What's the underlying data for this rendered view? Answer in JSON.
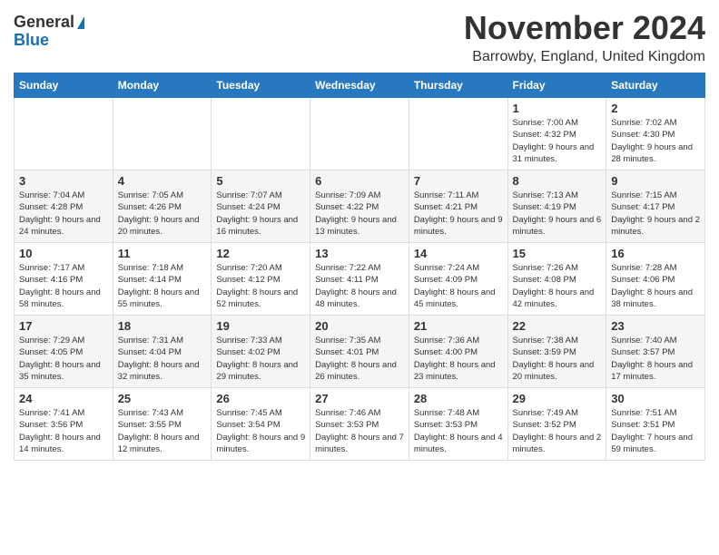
{
  "logo": {
    "general": "General",
    "blue": "Blue"
  },
  "title": "November 2024",
  "location": "Barrowby, England, United Kingdom",
  "days_header": [
    "Sunday",
    "Monday",
    "Tuesday",
    "Wednesday",
    "Thursday",
    "Friday",
    "Saturday"
  ],
  "weeks": [
    [
      {
        "day": "",
        "info": ""
      },
      {
        "day": "",
        "info": ""
      },
      {
        "day": "",
        "info": ""
      },
      {
        "day": "",
        "info": ""
      },
      {
        "day": "",
        "info": ""
      },
      {
        "day": "1",
        "info": "Sunrise: 7:00 AM\nSunset: 4:32 PM\nDaylight: 9 hours and 31 minutes."
      },
      {
        "day": "2",
        "info": "Sunrise: 7:02 AM\nSunset: 4:30 PM\nDaylight: 9 hours and 28 minutes."
      }
    ],
    [
      {
        "day": "3",
        "info": "Sunrise: 7:04 AM\nSunset: 4:28 PM\nDaylight: 9 hours and 24 minutes."
      },
      {
        "day": "4",
        "info": "Sunrise: 7:05 AM\nSunset: 4:26 PM\nDaylight: 9 hours and 20 minutes."
      },
      {
        "day": "5",
        "info": "Sunrise: 7:07 AM\nSunset: 4:24 PM\nDaylight: 9 hours and 16 minutes."
      },
      {
        "day": "6",
        "info": "Sunrise: 7:09 AM\nSunset: 4:22 PM\nDaylight: 9 hours and 13 minutes."
      },
      {
        "day": "7",
        "info": "Sunrise: 7:11 AM\nSunset: 4:21 PM\nDaylight: 9 hours and 9 minutes."
      },
      {
        "day": "8",
        "info": "Sunrise: 7:13 AM\nSunset: 4:19 PM\nDaylight: 9 hours and 6 minutes."
      },
      {
        "day": "9",
        "info": "Sunrise: 7:15 AM\nSunset: 4:17 PM\nDaylight: 9 hours and 2 minutes."
      }
    ],
    [
      {
        "day": "10",
        "info": "Sunrise: 7:17 AM\nSunset: 4:16 PM\nDaylight: 8 hours and 58 minutes."
      },
      {
        "day": "11",
        "info": "Sunrise: 7:18 AM\nSunset: 4:14 PM\nDaylight: 8 hours and 55 minutes."
      },
      {
        "day": "12",
        "info": "Sunrise: 7:20 AM\nSunset: 4:12 PM\nDaylight: 8 hours and 52 minutes."
      },
      {
        "day": "13",
        "info": "Sunrise: 7:22 AM\nSunset: 4:11 PM\nDaylight: 8 hours and 48 minutes."
      },
      {
        "day": "14",
        "info": "Sunrise: 7:24 AM\nSunset: 4:09 PM\nDaylight: 8 hours and 45 minutes."
      },
      {
        "day": "15",
        "info": "Sunrise: 7:26 AM\nSunset: 4:08 PM\nDaylight: 8 hours and 42 minutes."
      },
      {
        "day": "16",
        "info": "Sunrise: 7:28 AM\nSunset: 4:06 PM\nDaylight: 8 hours and 38 minutes."
      }
    ],
    [
      {
        "day": "17",
        "info": "Sunrise: 7:29 AM\nSunset: 4:05 PM\nDaylight: 8 hours and 35 minutes."
      },
      {
        "day": "18",
        "info": "Sunrise: 7:31 AM\nSunset: 4:04 PM\nDaylight: 8 hours and 32 minutes."
      },
      {
        "day": "19",
        "info": "Sunrise: 7:33 AM\nSunset: 4:02 PM\nDaylight: 8 hours and 29 minutes."
      },
      {
        "day": "20",
        "info": "Sunrise: 7:35 AM\nSunset: 4:01 PM\nDaylight: 8 hours and 26 minutes."
      },
      {
        "day": "21",
        "info": "Sunrise: 7:36 AM\nSunset: 4:00 PM\nDaylight: 8 hours and 23 minutes."
      },
      {
        "day": "22",
        "info": "Sunrise: 7:38 AM\nSunset: 3:59 PM\nDaylight: 8 hours and 20 minutes."
      },
      {
        "day": "23",
        "info": "Sunrise: 7:40 AM\nSunset: 3:57 PM\nDaylight: 8 hours and 17 minutes."
      }
    ],
    [
      {
        "day": "24",
        "info": "Sunrise: 7:41 AM\nSunset: 3:56 PM\nDaylight: 8 hours and 14 minutes."
      },
      {
        "day": "25",
        "info": "Sunrise: 7:43 AM\nSunset: 3:55 PM\nDaylight: 8 hours and 12 minutes."
      },
      {
        "day": "26",
        "info": "Sunrise: 7:45 AM\nSunset: 3:54 PM\nDaylight: 8 hours and 9 minutes."
      },
      {
        "day": "27",
        "info": "Sunrise: 7:46 AM\nSunset: 3:53 PM\nDaylight: 8 hours and 7 minutes."
      },
      {
        "day": "28",
        "info": "Sunrise: 7:48 AM\nSunset: 3:53 PM\nDaylight: 8 hours and 4 minutes."
      },
      {
        "day": "29",
        "info": "Sunrise: 7:49 AM\nSunset: 3:52 PM\nDaylight: 8 hours and 2 minutes."
      },
      {
        "day": "30",
        "info": "Sunrise: 7:51 AM\nSunset: 3:51 PM\nDaylight: 7 hours and 59 minutes."
      }
    ]
  ]
}
